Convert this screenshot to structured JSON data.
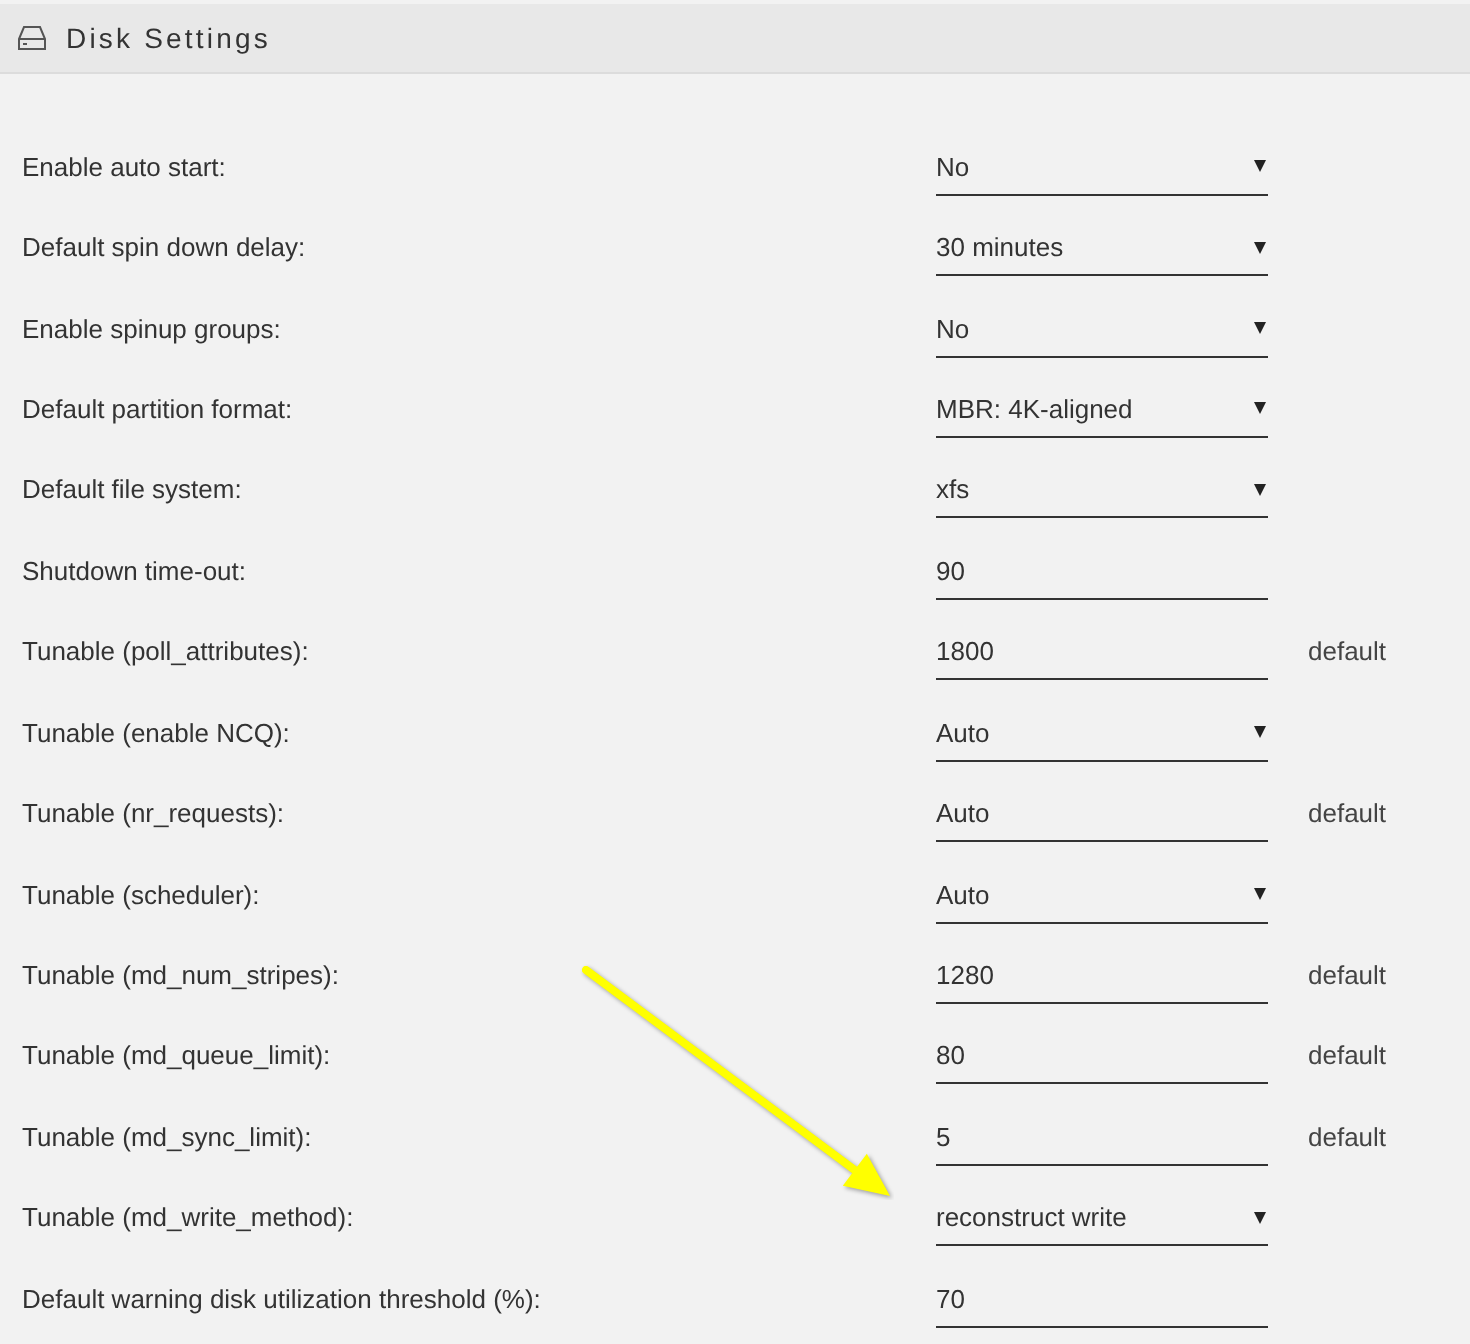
{
  "panel": {
    "title": "Disk Settings"
  },
  "settings": [
    {
      "label": "Enable auto start:",
      "kind": "select",
      "value": "No"
    },
    {
      "label": "Default spin down delay:",
      "kind": "select",
      "value": "30 minutes"
    },
    {
      "label": "Enable spinup groups:",
      "kind": "select",
      "value": "No"
    },
    {
      "label": "Default partition format:",
      "kind": "select",
      "value": "MBR: 4K-aligned"
    },
    {
      "label": "Default file system:",
      "kind": "select",
      "value": "xfs"
    },
    {
      "label": "Shutdown time-out:",
      "kind": "text",
      "value": "90"
    },
    {
      "label": "Tunable (poll_attributes):",
      "kind": "text",
      "value": "1800",
      "note": "default"
    },
    {
      "label": "Tunable (enable NCQ):",
      "kind": "select",
      "value": "Auto"
    },
    {
      "label": "Tunable (nr_requests):",
      "kind": "text",
      "value": "Auto",
      "note": "default"
    },
    {
      "label": "Tunable (scheduler):",
      "kind": "select",
      "value": "Auto"
    },
    {
      "label": "Tunable (md_num_stripes):",
      "kind": "text",
      "value": "1280",
      "note": "default"
    },
    {
      "label": "Tunable (md_queue_limit):",
      "kind": "text",
      "value": "80",
      "note": "default"
    },
    {
      "label": "Tunable (md_sync_limit):",
      "kind": "text",
      "value": "5",
      "note": "default"
    },
    {
      "label": "Tunable (md_write_method):",
      "kind": "select",
      "value": "reconstruct write"
    },
    {
      "label": "Default warning disk utilization threshold (%):",
      "kind": "text",
      "value": "70"
    }
  ]
}
